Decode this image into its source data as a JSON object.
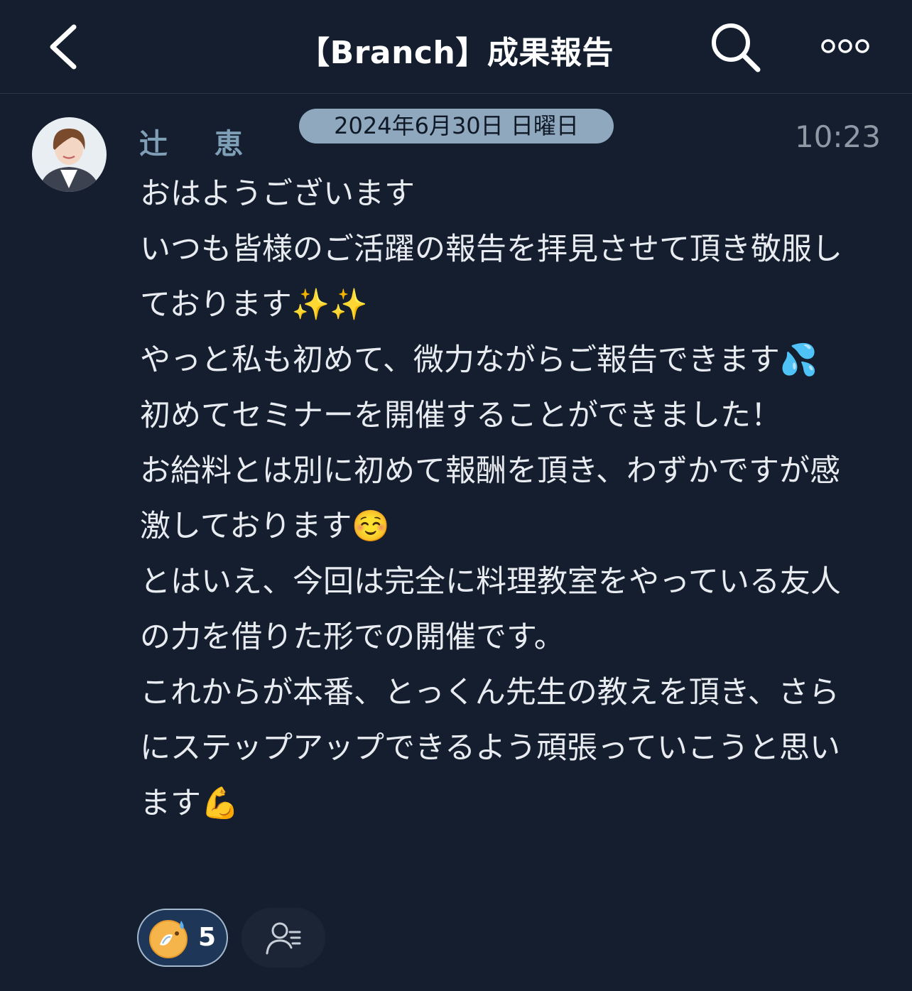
{
  "header": {
    "title": "【Branch】成果報告",
    "back_icon": "chevron-left-icon",
    "search_icon": "search-icon",
    "more_icon": "more-dots-icon"
  },
  "message": {
    "sender": "辻 恵",
    "date": "2024年6月30日 日曜日",
    "time": "10:23",
    "text": "おはようございます\nいつも皆様のご活躍の報告を拝見させて頂き敬服しております✨✨\nやっと私も初めて、微力ながらご報告できます💦\n初めてセミナーを開催することができました！\nお給料とは別に初めて報酬を頂き、わずかですが感激しております☺️\nとはいえ、今回は完全に料理教室をやっている友人の力を借りた形での開催です。\nこれからが本番、とっくん先生の教えを頂き、さらにステップアップできるよう頑張っていこうと思います💪"
  },
  "reactions": {
    "count": "5",
    "emoji_icon": "crying-face-emoji-icon",
    "readers_icon": "read-by-users-icon"
  },
  "colors": {
    "background": "#141e2f",
    "sender": "#7f9fb6",
    "date_pill": "#8fa8bd",
    "reaction_pill": "#1e3658"
  }
}
